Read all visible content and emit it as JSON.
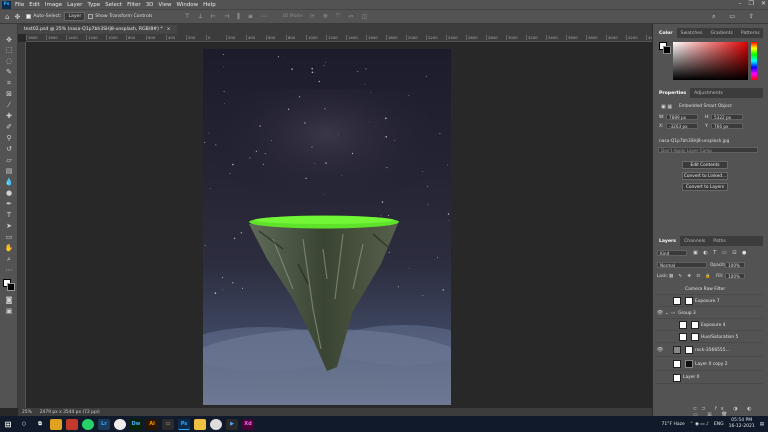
{
  "menubar": {
    "app_icon": "Ps",
    "items": [
      "File",
      "Edit",
      "Image",
      "Layer",
      "Type",
      "Select",
      "Filter",
      "3D",
      "View",
      "Window",
      "Help"
    ]
  },
  "options": {
    "auto_select": "Auto-Select:",
    "auto_select_target": "Layer",
    "show_transform": "Show Transform Controls",
    "mode_3d": "3D Mode:"
  },
  "document": {
    "tab_title": "test02.psd @ 25% (nasa-Q1p7bh3SHj8-unsplash, RGB/8#) *",
    "close": "×"
  },
  "ruler": {
    "ticks": [
      "1800",
      "1600",
      "1400",
      "1200",
      "1000",
      "800",
      "600",
      "400",
      "200",
      "0",
      "200",
      "400",
      "600",
      "800",
      "1000",
      "1200",
      "1400",
      "1600",
      "1800",
      "2000",
      "2200",
      "2400",
      "2600",
      "2800",
      "3000",
      "3200",
      "3400",
      "3600",
      "3800",
      "4000",
      "4200",
      "4400"
    ]
  },
  "status": {
    "zoom": "25%",
    "doc_size": "2479 px x 3544 px (72 ppi)"
  },
  "color_panel": {
    "tabs": [
      "Color",
      "Swatches",
      "Gradients",
      "Patterns"
    ]
  },
  "properties": {
    "tabs": [
      "Properties",
      "Adjustments"
    ],
    "type": "Embedded Smart Object",
    "w_label": "W:",
    "w": "7889 px",
    "h_label": "H:",
    "h": "5322 px",
    "x_label": "X:",
    "x": "-3263 px",
    "y_label": "Y:",
    "y": "766 px",
    "file": "nasa-Q1p7bh3SHj8-unsplash.jpg",
    "comps_placeholder": "Don't Apply Layer Comp",
    "buttons": [
      "Edit Contents",
      "Convert to Linked...",
      "Convert to Layers"
    ]
  },
  "layers": {
    "tabs": [
      "Layers",
      "Channels",
      "Paths"
    ],
    "filter_kind": "Kind",
    "blend_mode": "Normal",
    "opacity_label": "Opacity:",
    "opacity": "100%",
    "lock_label": "Lock:",
    "fill_label": "Fill:",
    "fill": "100%",
    "rows": [
      {
        "name": "Camera Raw Filter",
        "visible": false
      },
      {
        "name": "Exposure 7",
        "visible": false
      },
      {
        "name": "Group 3",
        "visible": true
      },
      {
        "name": "Exposure 4",
        "visible": false
      },
      {
        "name": "Hue/Saturation 5",
        "visible": false
      },
      {
        "name": "rock-3566555...",
        "visible": true
      },
      {
        "name": "Layer 0 copy 2",
        "visible": false
      },
      {
        "name": "Layer 0",
        "visible": false
      }
    ]
  },
  "taskbar": {
    "weather": "71°F Haze",
    "lang": "ENG",
    "time": "05:54 PM",
    "date": "16-12-2021"
  },
  "colors": {
    "accent": "#31a8ff",
    "grass": "#5ee22a",
    "panel": "#535353"
  }
}
